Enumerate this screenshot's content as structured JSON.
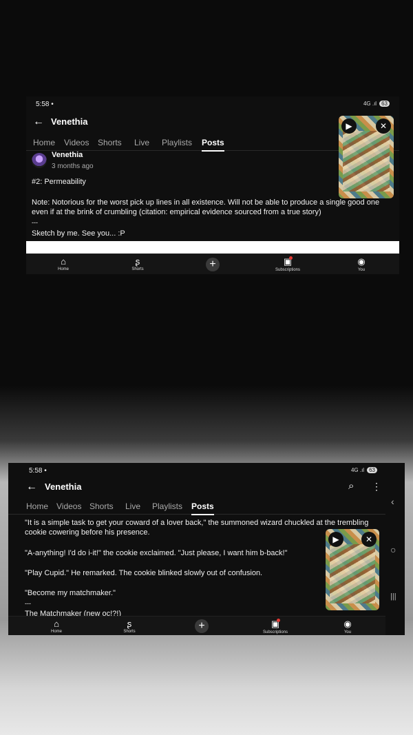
{
  "status": {
    "time": "5:58",
    "dot": "•",
    "signal": "4G .ıl",
    "battery": "63"
  },
  "panel1": {
    "channel": "Venethia",
    "tabs": [
      "Home",
      "Videos",
      "Shorts",
      "Live",
      "Playlists",
      "Posts"
    ],
    "active_tab": "Posts",
    "post": {
      "author": "Venethia",
      "time_ago": "3 months ago",
      "title": "#2: Permeability",
      "note": "Note: Notorious for the worst pick up lines in all existence. Will not be able to produce a single good one even if at the brink of crumbling (citation: empirical evidence sourced from a true story)",
      "separator": "---",
      "sketch_line": "Sketch by me. See you... :P"
    }
  },
  "panel2": {
    "channel": "Venethia",
    "tabs": [
      "Home",
      "Videos",
      "Shorts",
      "Live",
      "Playlists",
      "Posts"
    ],
    "active_tab": "Posts",
    "post": {
      "p1": "\"It is a simple task to get your coward of a lover back,\" the summoned wizard chuckled at the trembling cookie cowering before his presence.",
      "p2": "\"A-anything! I'd do i-it!\" the cookie exclaimed. \"Just please, I want him b-back!\"",
      "p3": "\"Play Cupid.\" He remarked. The cookie blinked slowly out of confusion.",
      "p4": "\"Become my matchmaker.\"",
      "separator": "---",
      "p5": "The Matchmaker (new oc!?!)"
    }
  },
  "navbar": {
    "home": "Home",
    "shorts": "Shorts",
    "subscriptions": "Subscriptions",
    "you": "You"
  },
  "icons": {
    "back": "back-arrow-icon",
    "search": "search-icon",
    "more": "more-vert-icon",
    "play": "play-icon",
    "close": "close-icon",
    "home": "home-icon",
    "shorts": "shorts-icon",
    "create": "plus-icon",
    "subscriptions": "subscriptions-icon",
    "you": "avatar-icon",
    "side_back": "chevron-left-icon",
    "side_home": "circle-icon",
    "side_recent": "recents-icon"
  }
}
